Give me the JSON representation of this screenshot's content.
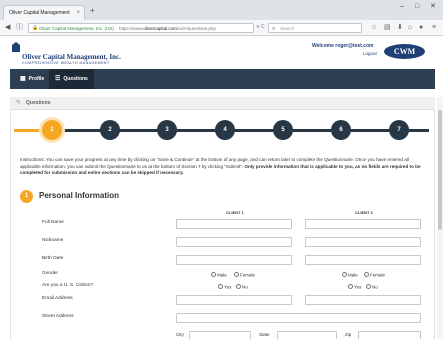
{
  "browser": {
    "tab_title": "Oliver Capital Management",
    "tab_close": "×",
    "new_tab": "+",
    "url_org": "Oliver Capital Management, Inc. (US)",
    "url_prefix": "https://www.",
    "url_domain": "olivercapital.com",
    "url_path": "/ocm/questions.php",
    "url_controls": "∨ C",
    "search_placeholder": "Search"
  },
  "header": {
    "company_name": "Oliver Capital Management, Inc.",
    "company_tagline": "COMPREHENSIVE WEALTH MANAGEMENT",
    "welcome": "Welcome roger@test.com",
    "logout": "Logout",
    "badge": "CWM"
  },
  "nav": {
    "items": [
      {
        "label": "Profile",
        "icon": "grid-icon"
      },
      {
        "label": "Questions",
        "icon": "list-icon"
      }
    ]
  },
  "section_header": {
    "title": "Questions"
  },
  "progress": {
    "current_step": 1,
    "steps": [
      "1",
      "2",
      "3",
      "4",
      "5",
      "6",
      "7"
    ],
    "colors": {
      "active": "#f5a623",
      "inactive": "#283746"
    }
  },
  "instructions": {
    "text": "Instructions: You can save your progress at any time by clicking on \"Save & Continue\" at the bottom of any page, and can return later to complete the Questionnaire. Once you have entered all applicable information, you can submit the Questionnaire to us at the bottom of Section 7 by clicking \"Submit\". ",
    "bold_text": "Only provide information that is applicable to you, as no fields are required to be completed for submission and entire sections can be skipped if necessary."
  },
  "section": {
    "number": "1",
    "title": "Personal Information"
  },
  "columns": [
    "CLIENT 1",
    "CLIENT 2"
  ],
  "fields": {
    "full_name": "Full Name",
    "nickname": "Nickname",
    "birth_date": "Birth Date",
    "gender": "Gender",
    "citizen": "Are you a U. S. Citizen?",
    "email": "Email Address",
    "street": "Street Address",
    "city": "City",
    "state": "State",
    "zip": "Zip"
  },
  "options": {
    "male": "Male",
    "female": "Female",
    "yes": "Yes",
    "no": "No"
  },
  "colors": {
    "brand": "#1f3f77",
    "nav_bg": "#2d3e50",
    "accent": "#f5a623"
  }
}
